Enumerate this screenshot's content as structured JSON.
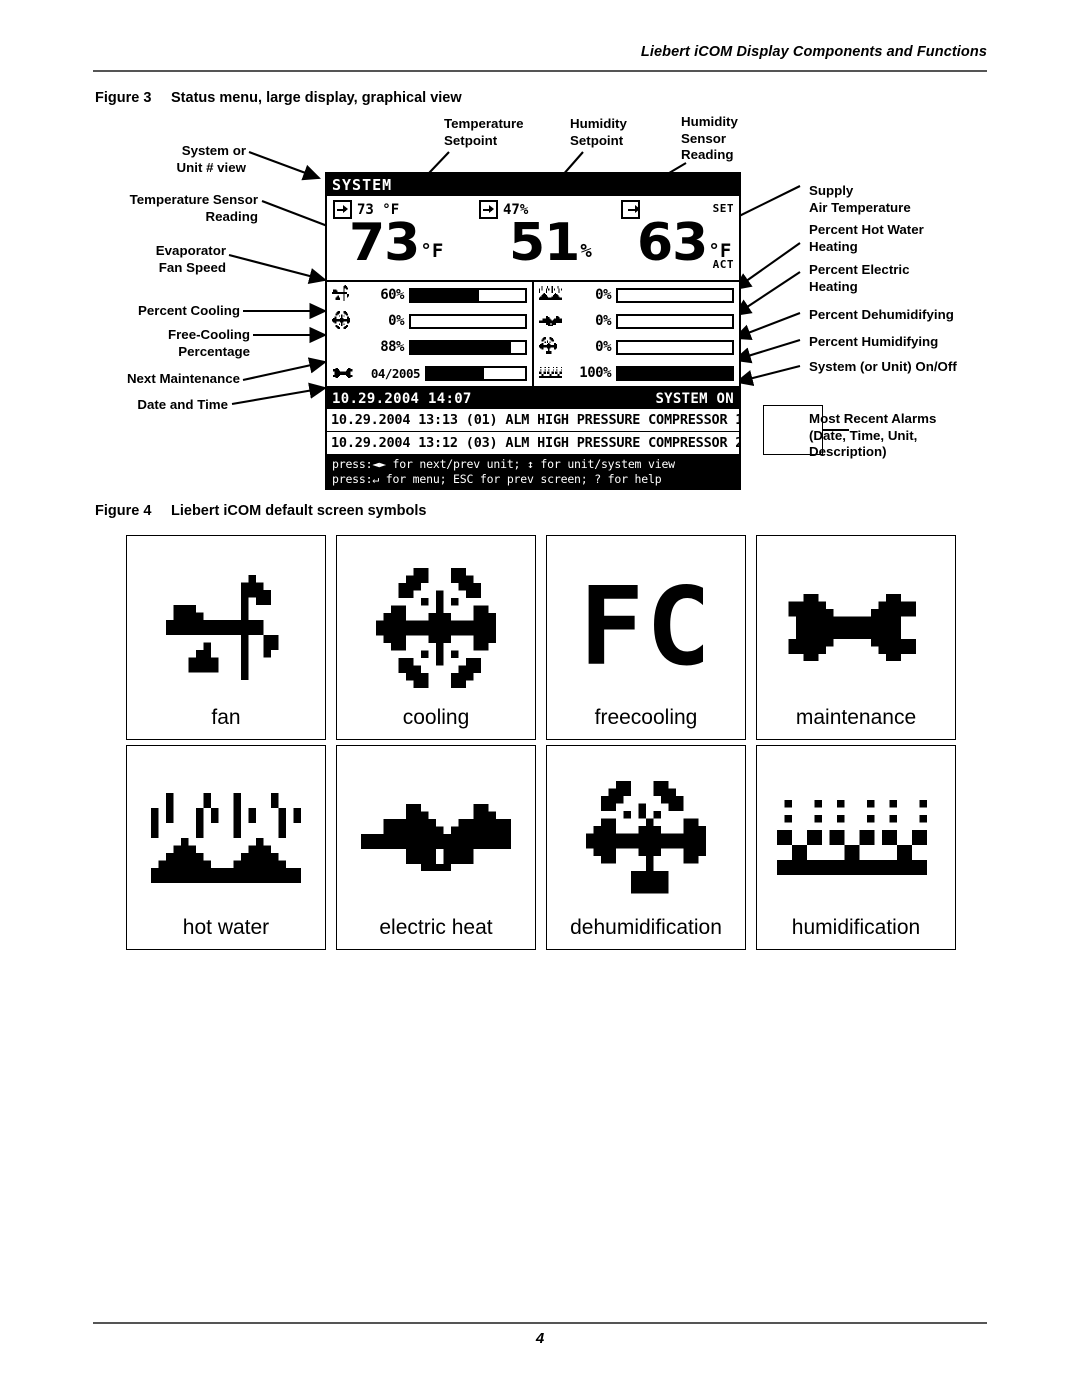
{
  "running_head": "Liebert iCOM Display Components and Functions",
  "page_number": "4",
  "figure3": {
    "number": "Figure 3",
    "title": "Status menu, large display, graphical view",
    "labels_left": [
      {
        "id": "system-or-unit-view",
        "text": "System or\nUnit # view"
      },
      {
        "id": "temperature-sensor-reading",
        "text": "Temperature Sensor\nReading"
      },
      {
        "id": "evaporator-fan-speed",
        "text": "Evaporator\nFan Speed"
      },
      {
        "id": "percent-cooling",
        "text": "Percent Cooling"
      },
      {
        "id": "free-cooling-percentage",
        "text": "Free-Cooling\nPercentage"
      },
      {
        "id": "next-maintenance",
        "text": "Next Maintenance"
      },
      {
        "id": "date-and-time",
        "text": "Date and Time"
      }
    ],
    "labels_top": [
      {
        "id": "temperature-setpoint",
        "text": "Temperature\nSetpoint"
      },
      {
        "id": "humidity-setpoint",
        "text": "Humidity\nSetpoint"
      },
      {
        "id": "humidity-sensor-reading",
        "text": "Humidity\nSensor\nReading"
      }
    ],
    "labels_right": [
      {
        "id": "supply-air-temperature",
        "text": "Supply\nAir Temperature"
      },
      {
        "id": "percent-hot-water-heating",
        "text": "Percent Hot Water\nHeating"
      },
      {
        "id": "percent-electric-heating",
        "text": "Percent Electric\nHeating"
      },
      {
        "id": "percent-dehumidifying",
        "text": "Percent Dehumidifying"
      },
      {
        "id": "percent-humidifying",
        "text": "Percent Humidifying"
      },
      {
        "id": "system-on-off",
        "text": "System (or Unit) On/Off"
      },
      {
        "id": "most-recent-alarms",
        "text": "Most Recent Alarms\n(Date, Time, Unit,\nDescription)"
      }
    ]
  },
  "lcd": {
    "title": "SYSTEM",
    "setpoints": [
      {
        "id": "temperature-setpoint",
        "icon": "arrow-into-box-icon",
        "value": "73 °F"
      },
      {
        "id": "humidity-setpoint",
        "icon": "arrow-into-box-icon",
        "value": "47%"
      },
      {
        "id": "supply-air",
        "icon": "arrow-out-of-box-icon",
        "value": ""
      }
    ],
    "readings": [
      {
        "id": "temperature-sensor-reading",
        "value": "73",
        "unit": "°F"
      },
      {
        "id": "humidity-sensor-reading",
        "value": "51",
        "unit": "%"
      },
      {
        "id": "supply-air-temperature",
        "value": "63",
        "unit": "°F"
      }
    ],
    "tag_set": "SET",
    "tag_act": "ACT",
    "bars_left": [
      {
        "id": "evaporator-fan-speed",
        "icon": "fan-icon",
        "value": "60%",
        "fill": 60
      },
      {
        "id": "percent-cooling",
        "icon": "cooling-icon",
        "value": "0%",
        "fill": 0
      },
      {
        "id": "free-cooling-percentage",
        "icon": "freecooling-icon",
        "value": "88%",
        "fill": 88
      },
      {
        "id": "next-maintenance",
        "icon": "maintenance-icon",
        "value": "04/2005",
        "fill": 58
      }
    ],
    "bars_right": [
      {
        "id": "percent-hot-water-heating",
        "icon": "hot-water-icon",
        "value": "0%",
        "fill": 0
      },
      {
        "id": "percent-electric-heating",
        "icon": "electric-heat-icon",
        "value": "0%",
        "fill": 0
      },
      {
        "id": "percent-dehumidifying",
        "icon": "dehumidification-icon",
        "value": "0%",
        "fill": 0
      },
      {
        "id": "percent-humidifying",
        "icon": "humidification-icon",
        "value": "100%",
        "fill": 100
      }
    ],
    "status_datetime": "10.29.2004 14:07",
    "status_state": "SYSTEM ON",
    "alarms": [
      "10.29.2004 13:13 (01) ALM HIGH PRESSURE COMPRESSOR 1",
      "10.29.2004 13:12 (03) ALM HIGH PRESSURE COMPRESSOR 2"
    ],
    "help_line1": "press:◄► for next/prev unit;  ↕ for  unit/system view",
    "help_line2": "press:↵ for menu;  ESC for prev screen;  ? for  help"
  },
  "figure4": {
    "number": "Figure 4",
    "title": "Liebert iCOM default screen symbols",
    "symbols": [
      {
        "id": "fan-icon",
        "caption": "fan"
      },
      {
        "id": "cooling-icon",
        "caption": "cooling"
      },
      {
        "id": "freecooling-icon",
        "caption": "freecooling"
      },
      {
        "id": "maintenance-icon",
        "caption": "maintenance"
      },
      {
        "id": "hot-water-icon",
        "caption": "hot water"
      },
      {
        "id": "electric-heat-icon",
        "caption": "electric heat"
      },
      {
        "id": "dehumidification-icon",
        "caption": "dehumidification"
      },
      {
        "id": "humidification-icon",
        "caption": "humidification"
      }
    ]
  }
}
